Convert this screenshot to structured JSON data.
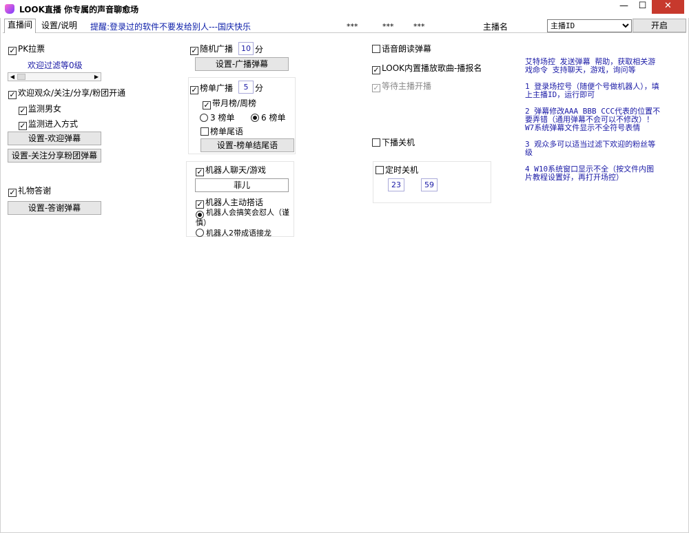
{
  "window": {
    "title": "LOOK直播 你专属的声音聊愈场"
  },
  "tabs": [
    {
      "label": "直播间"
    },
    {
      "label": "设置/说明"
    }
  ],
  "tip": "提醒:登录过的软件不要发给别人---国庆快乐",
  "stars": [
    "***",
    "***",
    "***"
  ],
  "anchor": {
    "label": "主播名",
    "select_value": "主播ID",
    "start_label": "开启"
  },
  "col1": {
    "pk": "PK拉票",
    "filter_label": "欢迎过滤等0级",
    "welcome": "欢迎观众/关注/分享/粉团开通",
    "detect_gender": "监测男女",
    "detect_entry": "监测进入方式",
    "set_welcome": "设置-欢迎弹幕",
    "set_follow": "设置-关注分享粉团弹幕",
    "gift_thanks": "礼物答谢",
    "set_thanks": "设置-答谢弹幕"
  },
  "col2": {
    "random_broadcast": "随机广播",
    "random_minutes": "10",
    "minute_unit": "分",
    "set_broadcast": "设置-广播弹幕",
    "rank_broadcast": "榜单广播",
    "rank_minutes": "5",
    "month_week": "带月榜/周榜",
    "rank3": "3 榜单",
    "rank6": "6 榜单",
    "rank_ending": "榜单尾语",
    "set_rank_ending": "设置-榜单结尾语",
    "robot_chat": "机器人聊天/游戏",
    "robot_name": "菲儿",
    "robot_active": "机器人主动搭话",
    "robot_joke": "机器人会搞笑会怼人（谨慎）",
    "robot_idiom": "机器人2带成语接龙"
  },
  "col3": {
    "voice_read": "语音朗读弹幕",
    "look_song": "LOOK内置播放歌曲-播报名",
    "wait_anchor": "等待主播开播",
    "off_shutdown": "下播关机",
    "timer_shutdown": "定时关机",
    "hour": "23",
    "minute": "59"
  },
  "info": {
    "p1": "艾特场控 发送弹幕 帮助，获取相关游戏命令 支持聊天，游戏，询问等",
    "p2": "1 登录场控号（随便个号做机器人），填上主播ID，运行即可",
    "p3": "2 弹幕修改AAA BBB CCC代表的位置不要弄错（通用弹幕不会可以不修改）！W7系统弹幕文件显示不全符号表情",
    "p4": "3 观众多可以适当过滤下欢迎的粉丝等级",
    "p5": "4 W10系统窗口显示不全（按文件内图片教程设置好，再打开场控）"
  }
}
